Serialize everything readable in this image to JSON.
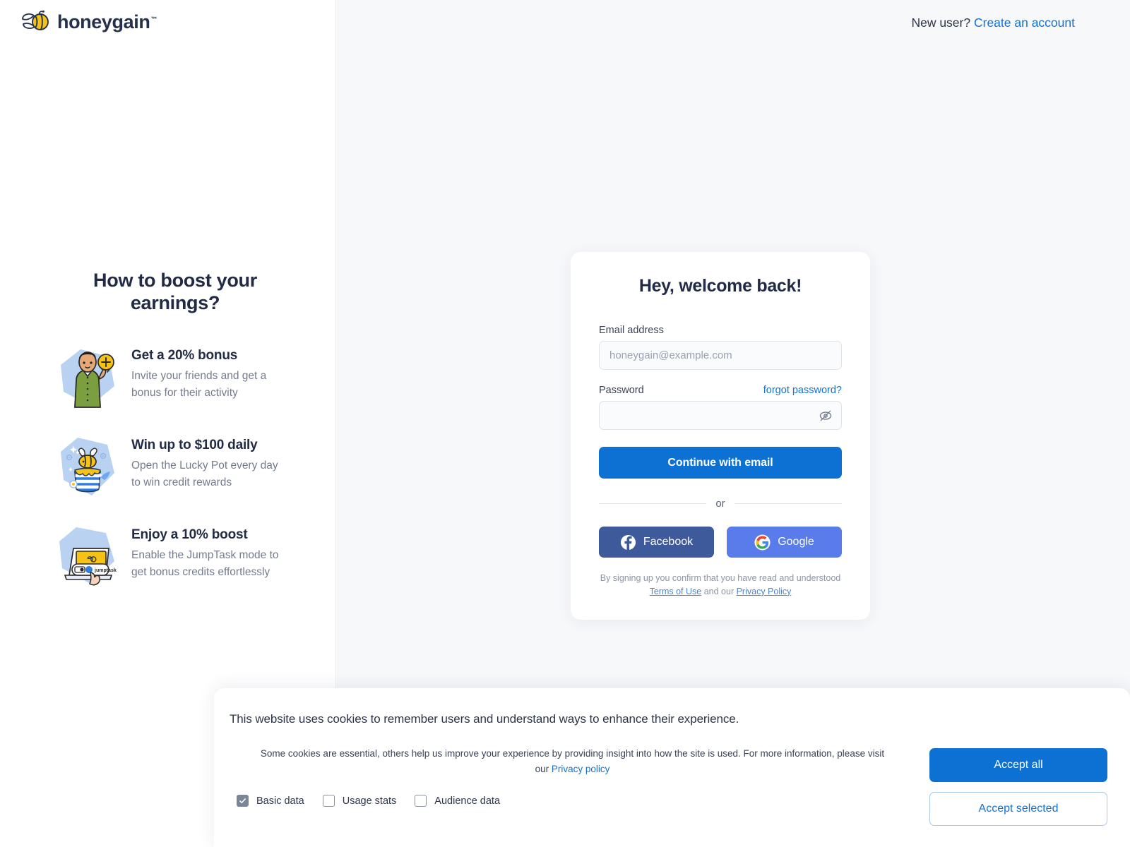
{
  "brand": {
    "name": "honeygain",
    "trademark": "™",
    "logo_icon": "bee-icon",
    "accent_blue": "#0d71d3",
    "link_blue": "#1272d6",
    "navy": "#212b45",
    "honey_yellow": "#f5c215"
  },
  "topbar": {
    "prompt": "New user?",
    "create_account_label": "Create an account"
  },
  "promo": {
    "title": "How to boost your earnings?",
    "items": [
      {
        "art": "person-plus-illustration",
        "heading": "Get a 20% bonus",
        "body": "Invite your friends and get a bonus for their activity"
      },
      {
        "art": "honey-pot-bee-illustration",
        "heading": "Win up to $100 daily",
        "body": "Open the Lucky Pot every day to win credit rewards"
      },
      {
        "art": "laptop-jumptask-illustration",
        "heading": "Enjoy a 10% boost",
        "body": "Enable the JumpTask mode to get bonus credits effortlessly"
      }
    ]
  },
  "login": {
    "title": "Hey, welcome back!",
    "email_label": "Email address",
    "email_placeholder": "honeygain@example.com",
    "email_value": "",
    "password_label": "Password",
    "password_value": "",
    "forgot_label": "forgot password?",
    "toggle_password_icon": "eye-slash-icon",
    "submit_label": "Continue with email",
    "divider_label": "or",
    "social": [
      {
        "label": "Facebook",
        "icon": "facebook-icon",
        "color": "#3f5a9a"
      },
      {
        "label": "Google",
        "icon": "google-icon",
        "color": "#5a7ceb"
      }
    ],
    "legal_prefix": "By signing up you confirm that you have read and understood",
    "terms_label": "Terms of Use",
    "legal_middle": " and our ",
    "privacy_label": "Privacy Policy"
  },
  "cookies": {
    "heading": "This website uses cookies to remember users and understand ways to enhance their experience.",
    "body_prefix": "Some cookies are essential, others help us improve your experience by providing insight into how the site is used. For more information, please visit our ",
    "privacy_link_label": "Privacy policy",
    "options": [
      {
        "label": "Basic data",
        "checked": true
      },
      {
        "label": "Usage stats",
        "checked": false
      },
      {
        "label": "Audience data",
        "checked": false
      }
    ],
    "accept_all_label": "Accept all",
    "accept_selected_label": "Accept selected"
  }
}
